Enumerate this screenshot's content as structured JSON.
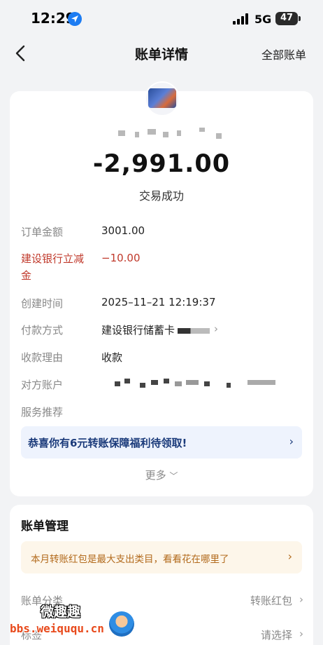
{
  "status_bar": {
    "time": "12:29",
    "network": "5G",
    "battery": "47",
    "icons": [
      "location-arrow-icon",
      "signal-icon",
      "battery-icon"
    ]
  },
  "nav": {
    "title": "账单详情",
    "right_link": "全部账单",
    "back_icon": "chevron-left-icon"
  },
  "transaction": {
    "amount": "-2,991.00",
    "status": "交易成功"
  },
  "details": [
    {
      "label": "订单金额",
      "value": "3001.00"
    },
    {
      "label": "建设银行立减金",
      "value": "−10.00",
      "highlight": "#c0392b"
    },
    {
      "label": "创建时间",
      "value": "2025–11–21 12:19:37"
    },
    {
      "label": "付款方式",
      "value": "建设银行储蓄卡"
    },
    {
      "label": "收款理由",
      "value": "收款"
    },
    {
      "label": "对方账户",
      "value": ""
    },
    {
      "label": "服务推荐",
      "value": ""
    }
  ],
  "promo": {
    "text": "恭喜你有6元转账保障福利待领取!"
  },
  "more": {
    "label": "更多"
  },
  "manage": {
    "title": "账单管理",
    "tip": "本月转账红包是最大支出类目，看看花在哪里了",
    "rows": [
      {
        "label": "账单分类",
        "value": "转账红包"
      },
      {
        "label": "标签",
        "value": "请选择"
      }
    ]
  },
  "watermark": {
    "cn": "微趣趣",
    "url": "bbs.weiququ.cn"
  },
  "colors": {
    "background": "#f2f3f5",
    "accent_red": "#c0392b",
    "promo_bg": "#eef3fd",
    "promo_text": "#1a3a7a",
    "tip_bg": "#fdf6ea",
    "tip_text": "#b26a1c"
  }
}
